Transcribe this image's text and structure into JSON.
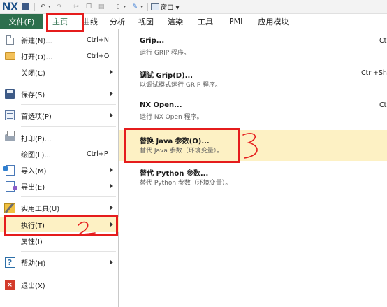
{
  "app": {
    "logo": "NX",
    "window_menu_label": "窗口 ▾"
  },
  "quick_access": {
    "icons": [
      "save-icon",
      "undo-icon",
      "redo-icon",
      "cut-icon",
      "copy-icon",
      "paste-icon",
      "new-icon",
      "touch-icon",
      "window-icon"
    ]
  },
  "ribbon": {
    "file_tab": "文件(F)",
    "tabs": [
      "主页",
      "曲线",
      "分析",
      "视图",
      "渲染",
      "工具",
      "PMI",
      "应用模块"
    ]
  },
  "file_menu": {
    "items": [
      {
        "label": "新建(N)...",
        "shortcut": "Ctrl+N",
        "icon": "new-document-icon",
        "has_submenu": false
      },
      {
        "label": "打开(O)...",
        "shortcut": "Ctrl+O",
        "icon": "open-folder-icon",
        "has_submenu": false
      },
      {
        "label": "关闭(C)",
        "shortcut": "",
        "icon": "",
        "has_submenu": true
      },
      {
        "label": "保存(S)",
        "shortcut": "",
        "icon": "save-icon",
        "has_submenu": true
      },
      {
        "label": "首选项(P)",
        "shortcut": "",
        "icon": "preferences-icon",
        "has_submenu": true
      },
      {
        "label": "打印(P)...",
        "shortcut": "",
        "icon": "print-icon",
        "has_submenu": false
      },
      {
        "label": "绘图(L)...",
        "shortcut": "Ctrl+P",
        "icon": "",
        "has_submenu": false
      },
      {
        "label": "导入(M)",
        "shortcut": "",
        "icon": "import-icon",
        "has_submenu": true
      },
      {
        "label": "导出(E)",
        "shortcut": "",
        "icon": "export-icon",
        "has_submenu": true
      },
      {
        "label": "实用工具(U)",
        "shortcut": "",
        "icon": "utilities-icon",
        "has_submenu": true
      },
      {
        "label": "执行(T)",
        "shortcut": "",
        "icon": "",
        "has_submenu": true,
        "active": true
      },
      {
        "label": "属性(I)",
        "shortcut": "",
        "icon": "",
        "has_submenu": false
      },
      {
        "label": "帮助(H)",
        "shortcut": "",
        "icon": "help-icon",
        "has_submenu": true
      },
      {
        "label": "退出(X)",
        "shortcut": "",
        "icon": "exit-icon",
        "has_submenu": false
      }
    ]
  },
  "execute_submenu": {
    "items": [
      {
        "title": "Grip...",
        "description": "运行 GRIP 程序。",
        "shortcut": "Ct"
      },
      {
        "title": "调试 Grip(D)...",
        "description": "以调试模式运行 GRIP 程序。",
        "shortcut": "Ctrl+Shi"
      },
      {
        "title": "NX Open...",
        "description": "运行 NX Open 程序。",
        "shortcut": "Ct"
      },
      {
        "title": "替换 Java 参数(O)...",
        "description": "替代 Java 参数（环境变量）。",
        "shortcut": "",
        "active": true
      },
      {
        "title": "替代 Python 参数...",
        "description": "替代 Python 参数（环境变量）。",
        "shortcut": ""
      }
    ]
  },
  "colors": {
    "file_tab_bg": "#2d6f4d",
    "highlight_bg": "#fdf1c4",
    "annotation_red": "#e51c1c",
    "logo_blue": "#1b4f87"
  }
}
